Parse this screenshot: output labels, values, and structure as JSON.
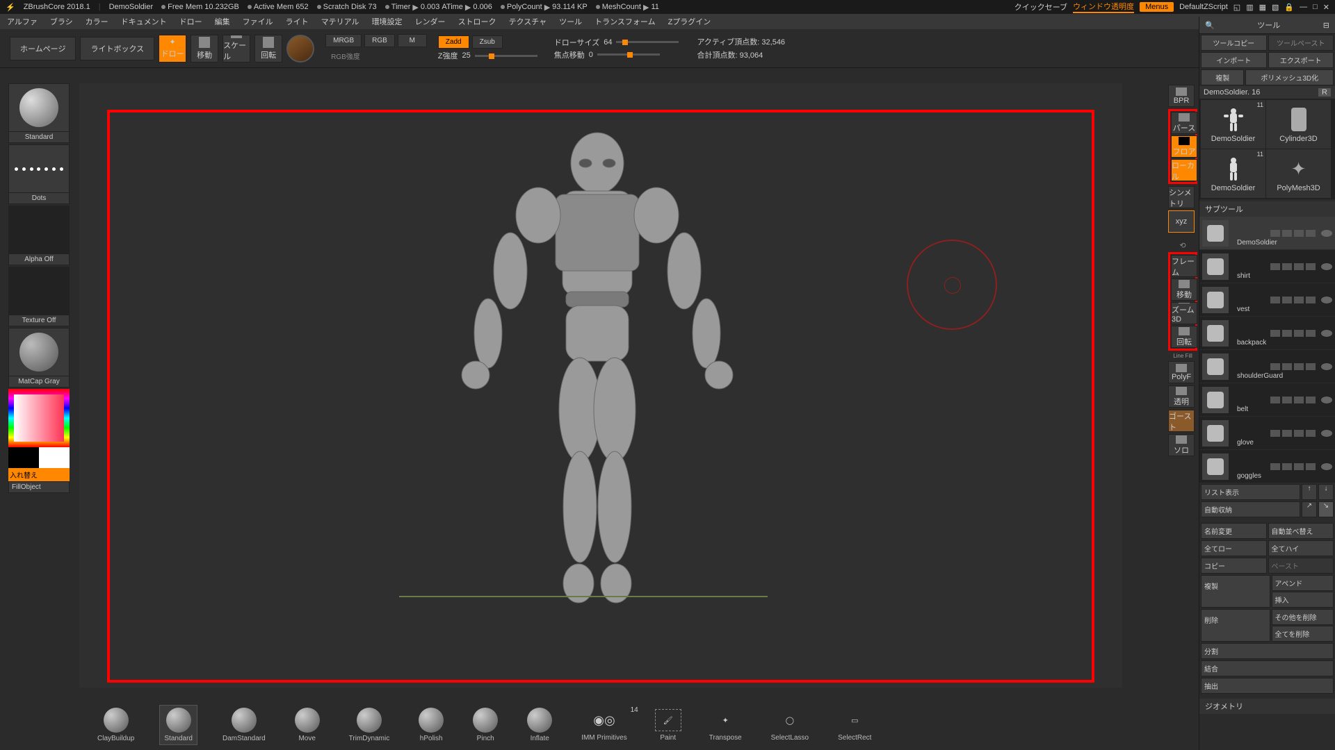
{
  "status": {
    "app": "ZBrushCore 2018.1",
    "project": "DemoSoldier",
    "freemem_l": "Free Mem",
    "freemem_v": "10.232GB",
    "activemem_l": "Active Mem",
    "activemem_v": "652",
    "scratch_l": "Scratch Disk",
    "scratch_v": "73",
    "timer_l": "Timer",
    "timer_v": "0.003",
    "atime_l": "ATime",
    "atime_v": "0.006",
    "poly_l": "PolyCount",
    "poly_v": "93.114 KP",
    "mesh_l": "MeshCount",
    "mesh_v": "11",
    "quicksave": "クイックセーブ",
    "wintrans": "ウィンドウ透明度",
    "menus": "Menus",
    "defaultz": "DefaultZScript"
  },
  "menu": [
    "アルファ",
    "ブラシ",
    "カラー",
    "ドキュメント",
    "ドロー",
    "編集",
    "ファイル",
    "ライト",
    "マテリアル",
    "環境設定",
    "レンダー",
    "ストローク",
    "テクスチャ",
    "ツール",
    "トランスフォーム",
    "Zプラグイン"
  ],
  "toolbar": {
    "home": "ホームページ",
    "lightbox": "ライトボックス",
    "draw": "ドロー",
    "move": "移動",
    "scale": "スケール",
    "rotate": "回転",
    "mrgb": "MRGB",
    "rgb": "RGB",
    "m": "M",
    "rgbint": "RGB強度",
    "zadd": "Zadd",
    "zsub": "Zsub",
    "zint": "Z強度",
    "zint_v": "25",
    "drawsize": "ドローサイズ",
    "drawsize_v": "64",
    "focal": "焦点移動",
    "focal_v": "0",
    "active_pts": "アクティブ頂点数:",
    "active_pts_v": "32,546",
    "total_pts": "合計頂点数:",
    "total_pts_v": "93,064"
  },
  "left": {
    "brush": "Standard",
    "stroke": "Dots",
    "alpha": "Alpha Off",
    "texture": "Texture Off",
    "material": "MatCap Gray",
    "swap": "入れ替え",
    "fill": "FillObject"
  },
  "rshelf": {
    "bpr": "BPR",
    "persp": "パース",
    "floor": "フロア",
    "local": "ローカル",
    "sym": "シンメトリ",
    "xyz": "xyz",
    "frame": "フレーム",
    "move": "移動",
    "zoom": "ズーム3D",
    "rotate": "回転",
    "linefill": "Line Fill",
    "polyf": "PolyF",
    "trans": "透明",
    "ghost": "ゴースト",
    "solo": "ソロ"
  },
  "right": {
    "title": "ツール",
    "toolcopy": "ツールコピー",
    "toolpaste": "ツールペースト",
    "import": "インポート",
    "export": "エクスポート",
    "clone": "複製",
    "polymesh": "ポリメッシュ3D化",
    "toolname": "DemoSoldier.",
    "toolnum": "16",
    "r": "R",
    "tools": [
      {
        "name": "DemoSoldier",
        "num": "11"
      },
      {
        "name": "Cylinder3D",
        "num": ""
      },
      {
        "name": "DemoSoldier",
        "num": "11"
      },
      {
        "name": "PolyMesh3D",
        "num": ""
      }
    ],
    "subtool_h": "サブツール",
    "subtools": [
      "DemoSoldier",
      "shirt",
      "vest",
      "backpack",
      "shoulderGuard",
      "belt",
      "glove",
      "goggles"
    ],
    "listview": "リスト表示",
    "autocollapse": "自動収納",
    "rename": "名前変更",
    "autoreorder": "自動並べ替え",
    "alllow": "全てロー",
    "allhigh": "全てハイ",
    "copy": "コピー",
    "paste": "ペースト",
    "dup": "複製",
    "append": "アペンド",
    "insert": "挿入",
    "delete": "削除",
    "delother": "その他を削除",
    "delall": "全てを削除",
    "split": "分割",
    "merge": "結合",
    "extract": "抽出",
    "geometry": "ジオメトリ"
  },
  "tray": [
    "ClayBuildup",
    "Standard",
    "DamStandard",
    "Move",
    "TrimDynamic",
    "hPolish",
    "Pinch",
    "Inflate",
    "IMM Primitives",
    "Paint",
    "Transpose",
    "SelectLasso",
    "SelectRect"
  ],
  "tray_badge": "14"
}
